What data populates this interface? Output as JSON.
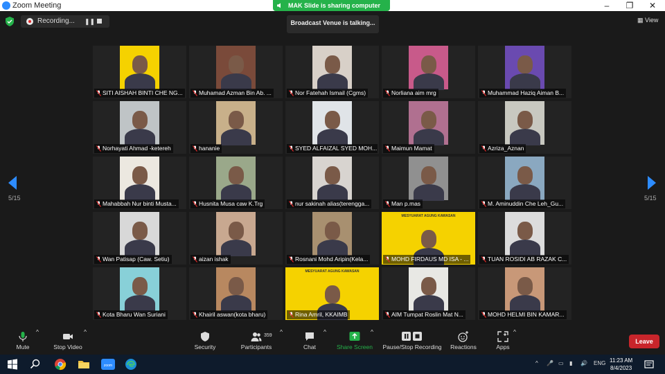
{
  "window": {
    "title": "Zoom Meeting",
    "controls": [
      "minimize",
      "restore",
      "close"
    ]
  },
  "share_banner": {
    "text": "MAK Slide is sharing computer sound"
  },
  "recording": {
    "label": "Recording..."
  },
  "talking": {
    "text": "Broadcast Venue is talking..."
  },
  "view_button": {
    "label": "View"
  },
  "pagination": {
    "left": "5/15",
    "right": "5/15"
  },
  "tiles": [
    {
      "name": "SITI AISHAH BINTI CHE NG...",
      "muted": true,
      "bg": "#f5d200"
    },
    {
      "name": "Muhamad Azman Bin Ab. ...",
      "muted": true,
      "bg": "#7a4a3a"
    },
    {
      "name": "Nor Fatehah Ismail (Cgms)",
      "muted": true,
      "bg": "#d8d0c8"
    },
    {
      "name": "Norliana aim mrg",
      "muted": true,
      "bg": "#c85a8a"
    },
    {
      "name": "Muhammad Haziq Aiman B...",
      "muted": true,
      "bg": "#6a4ab0"
    },
    {
      "name": "Norhayati Ahmad -ketereh",
      "muted": true,
      "bg": "#bfc4c6"
    },
    {
      "name": "hananie",
      "muted": true,
      "bg": "#c8b08a"
    },
    {
      "name": "SYED ALFAIZAL SYED MOH...",
      "muted": true,
      "bg": "#e0e4e8"
    },
    {
      "name": "Maimun Mamat",
      "muted": true,
      "bg": "#b07090"
    },
    {
      "name": "Azriza_Aznan",
      "muted": true,
      "bg": "#c8c8c0"
    },
    {
      "name": "Mahabbah Nur binti Musta...",
      "muted": true,
      "bg": "#ece8e0"
    },
    {
      "name": "Husnita Musa caw K.Trg",
      "muted": true,
      "bg": "#9aa88a"
    },
    {
      "name": "nur sakinah alias(terengga...",
      "muted": true,
      "bg": "#d8d4d0"
    },
    {
      "name": "Man p.mas",
      "muted": true,
      "bg": "#909090"
    },
    {
      "name": "M. Aminuddin Che Leh_Gu...",
      "muted": true,
      "bg": "#8aa8c0"
    },
    {
      "name": "Wan Patisap (Caw. Setiu)",
      "muted": true,
      "bg": "#d8d8d8"
    },
    {
      "name": "aizan ishak",
      "muted": true,
      "bg": "#c8a890"
    },
    {
      "name": "Rosnani Mohd Aripin(Kela...",
      "muted": true,
      "bg": "#a89070"
    },
    {
      "name": "MOHD FIRDAUS MD ISA - ...",
      "muted": true,
      "bg": "#f5d200",
      "wide": true,
      "banner": "MESYUARAT AGUNG KAWASAN"
    },
    {
      "name": "TUAN ROSIDI AB RAZAK C...",
      "muted": true,
      "bg": "#dcdcdc"
    },
    {
      "name": "Kota Bharu Wan Suriani",
      "muted": true,
      "bg": "#88d0d8"
    },
    {
      "name": "Khairil aswan(kota bharu)",
      "muted": true,
      "bg": "#b88860"
    },
    {
      "name": "Rina Amril, KKAIMB",
      "muted": true,
      "bg": "#f5d200",
      "wide": true,
      "banner": "MESYUARAT AGUNG KAWASAN"
    },
    {
      "name": "AIM Tumpat Roslin Mat N...",
      "muted": true,
      "bg": "#e8e8e4"
    },
    {
      "name": "MOHD HELMI BIN KAMAR...",
      "muted": true,
      "bg": "#c89878"
    }
  ],
  "toolbar": {
    "mute": "Mute",
    "stop_video": "Stop Video",
    "security": "Security",
    "participants": "Participants",
    "participants_count": "359",
    "chat": "Chat",
    "share_screen": "Share Screen",
    "pause_stop_recording": "Pause/Stop Recording",
    "reactions": "Reactions",
    "apps": "Apps",
    "leave": "Leave"
  },
  "taskbar": {
    "language": "ENG",
    "time": "11:23 AM",
    "date": "8/4/2023",
    "apps": [
      "start-icon",
      "search-icon",
      "chrome-icon",
      "file-explorer-icon",
      "zoom-icon",
      "edge-icon"
    ]
  },
  "colors": {
    "share_green": "#25b24a",
    "leave_red": "#c8252b",
    "zoom_blue": "#2d8cff",
    "tile_bg": "#232323"
  }
}
